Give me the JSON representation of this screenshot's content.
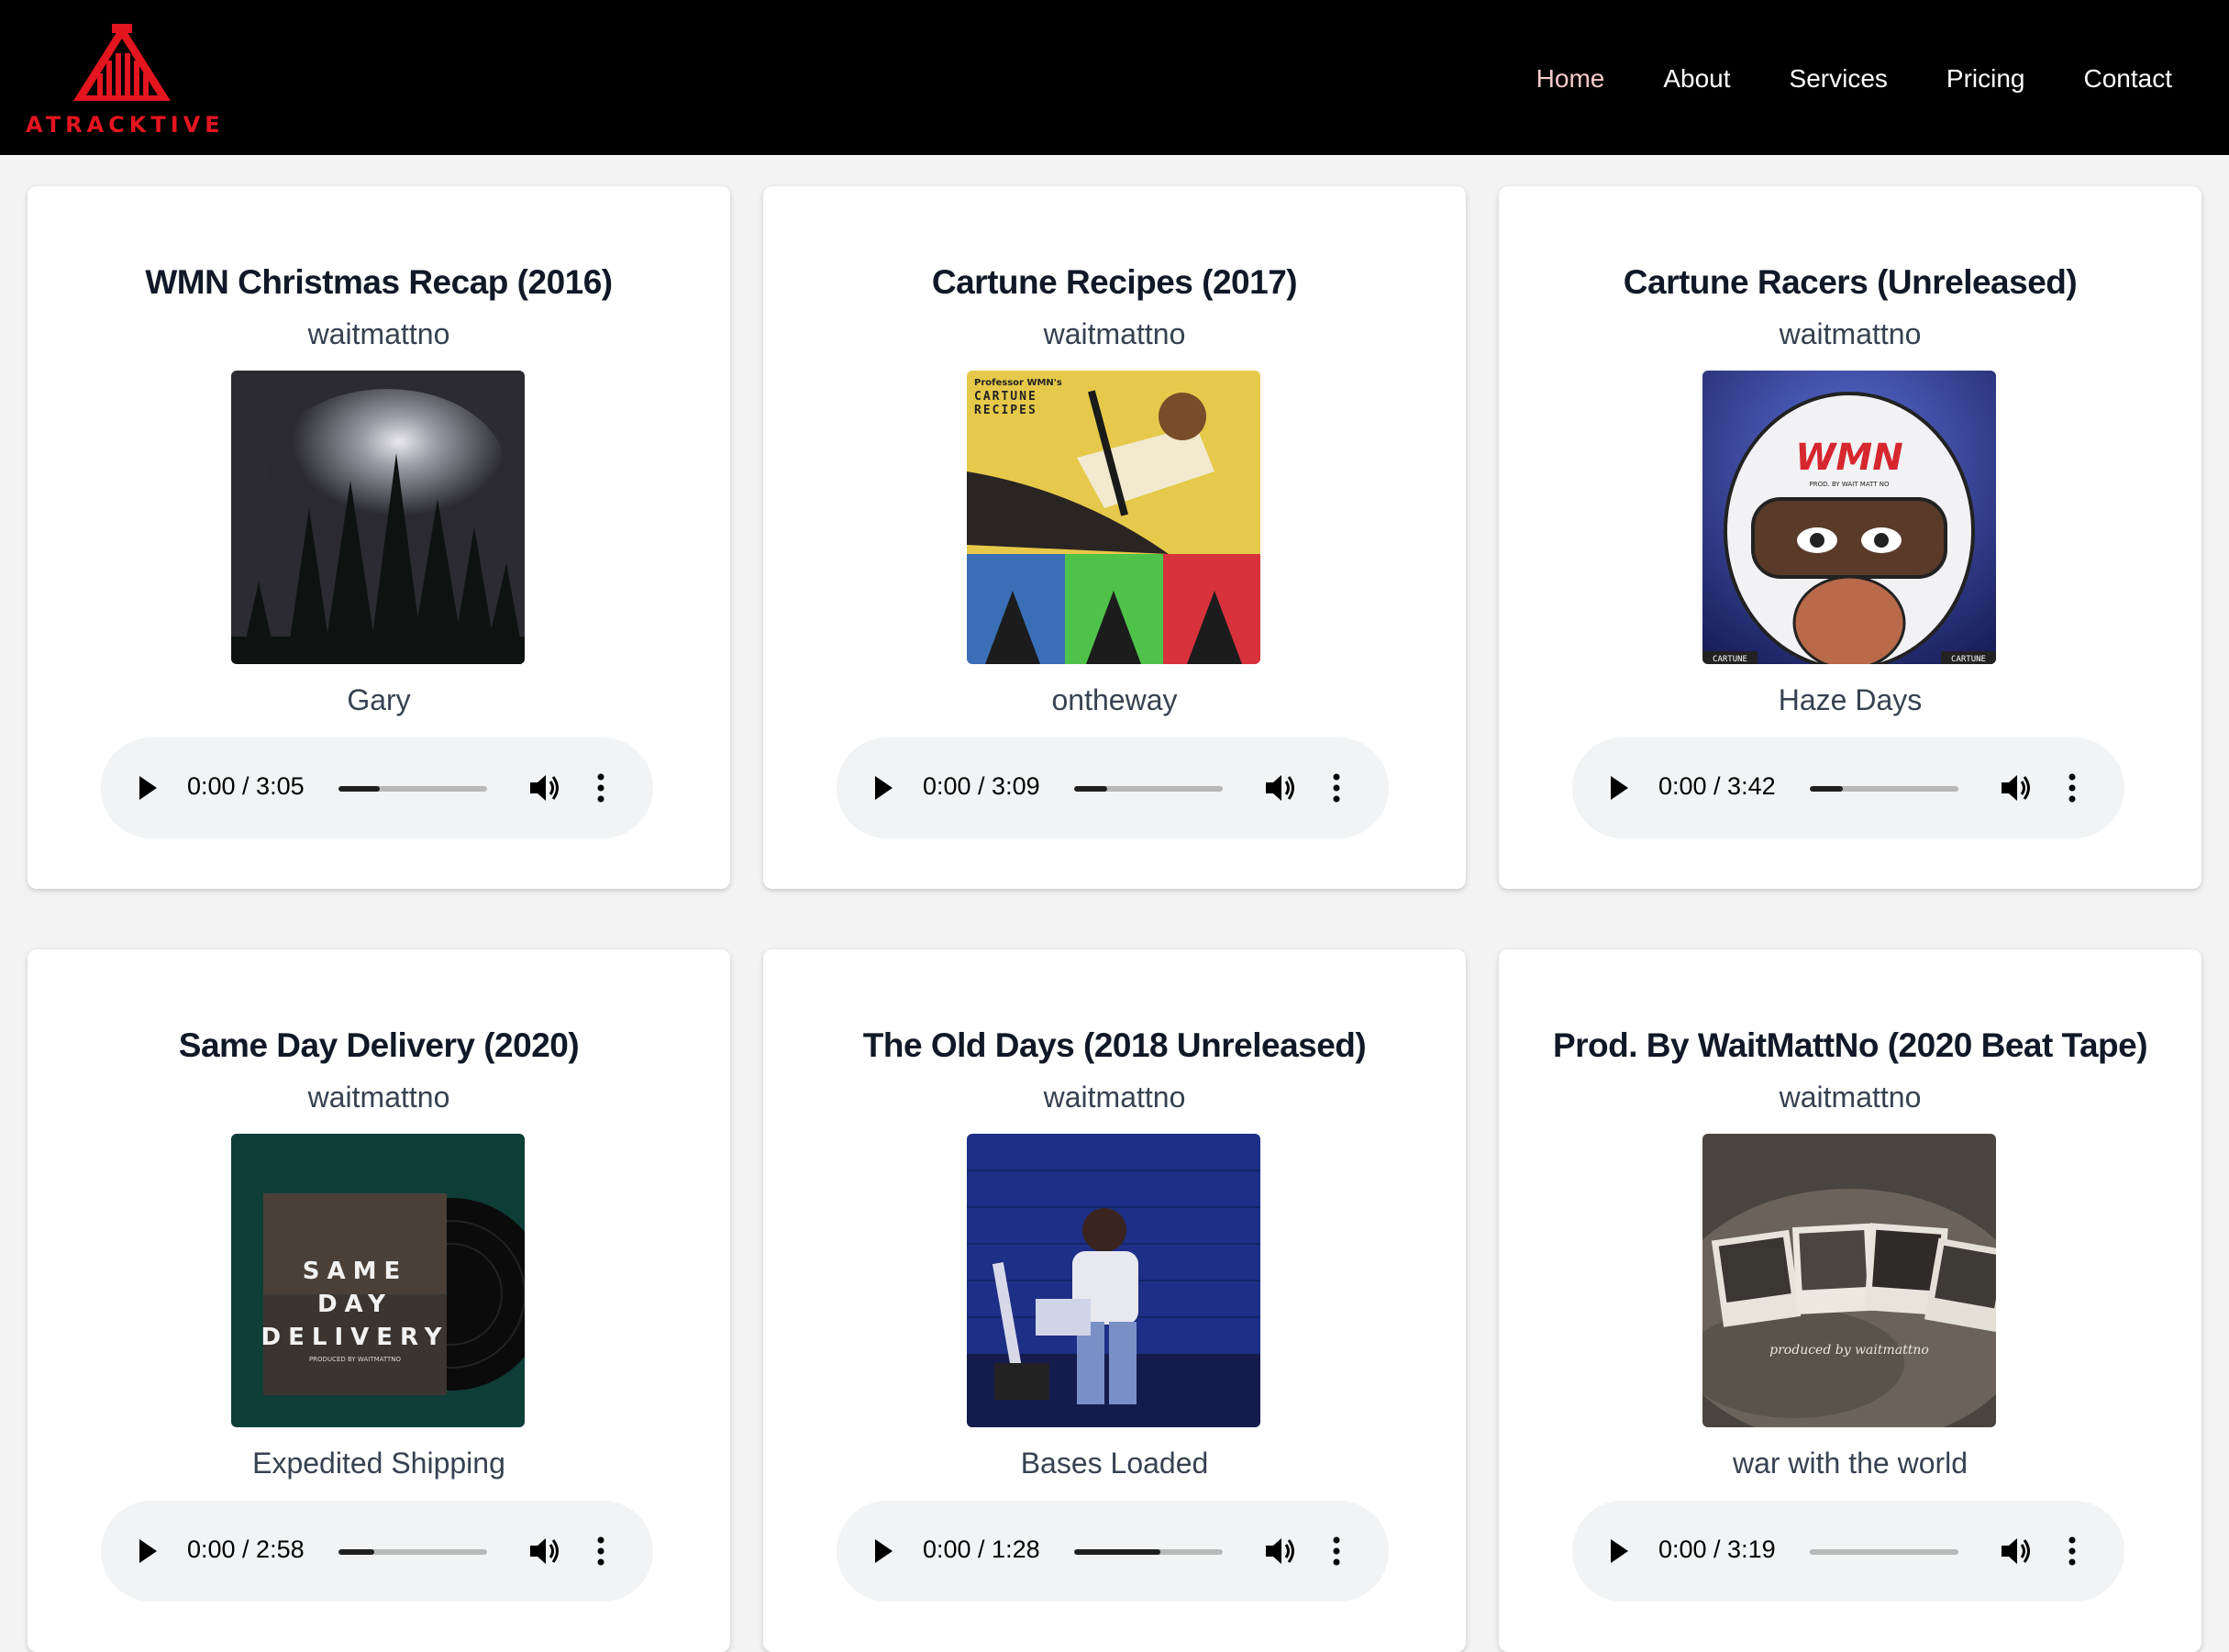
{
  "brand": {
    "name": "ATRACKTIVE",
    "logo_icon": "piano-mountain-logo-icon",
    "accent_color": "#e4151f"
  },
  "nav": {
    "items": [
      {
        "label": "Home",
        "active": true
      },
      {
        "label": "About",
        "active": false
      },
      {
        "label": "Services",
        "active": false
      },
      {
        "label": "Pricing",
        "active": false
      },
      {
        "label": "Contact",
        "active": false
      }
    ]
  },
  "cards": [
    {
      "title": "WMN Christmas Recap (2016)",
      "artist": "waitmattno",
      "track": "Gary",
      "time": "0:00 / 3:05",
      "progress": 0.28,
      "cover": "night-trees-fireworks"
    },
    {
      "title": "Cartune Recipes (2017)",
      "artist": "waitmattno",
      "track": "ontheway",
      "time": "0:00 / 3:09",
      "progress": 0.22,
      "cover": "cartune-recipes-art"
    },
    {
      "title": "Cartune Racers (Unreleased)",
      "artist": "waitmattno",
      "track": "Haze Days",
      "time": "0:00 / 3:42",
      "progress": 0.22,
      "cover": "racer-helmet-art"
    },
    {
      "title": "Same Day Delivery (2020)",
      "artist": "waitmattno",
      "track": "Expedited Shipping",
      "time": "0:00 / 2:58",
      "progress": 0.24,
      "cover": "same-day-delivery-art"
    },
    {
      "title": "The Old Days (2018 Unreleased)",
      "artist": "waitmattno",
      "track": "Bases Loaded",
      "time": "0:00 / 1:28",
      "progress": 0.58,
      "cover": "blue-studio-photo"
    },
    {
      "title": "Prod. By WaitMattNo (2020 Beat Tape)",
      "artist": "waitmattno",
      "track": "war with the world",
      "time": "0:00 / 3:19",
      "progress": 0.0,
      "cover": "polaroids-fur-photo"
    }
  ],
  "cover_texts": {
    "cartune_header": "Professor WMN's",
    "cartune_word1": "CARTUNE",
    "cartune_word2": "RECIPES",
    "racer_helmet": "WMN",
    "racer_sub": "PROD. BY WAIT MATT NO",
    "racer_badge": "CARTUNE",
    "delivery_line1": "SAME",
    "delivery_line2": "DAY",
    "delivery_line3": "DELIVERY",
    "delivery_sub": "PRODUCED BY WAITMATTNO",
    "polaroid_caption": "produced by waitmattno"
  }
}
